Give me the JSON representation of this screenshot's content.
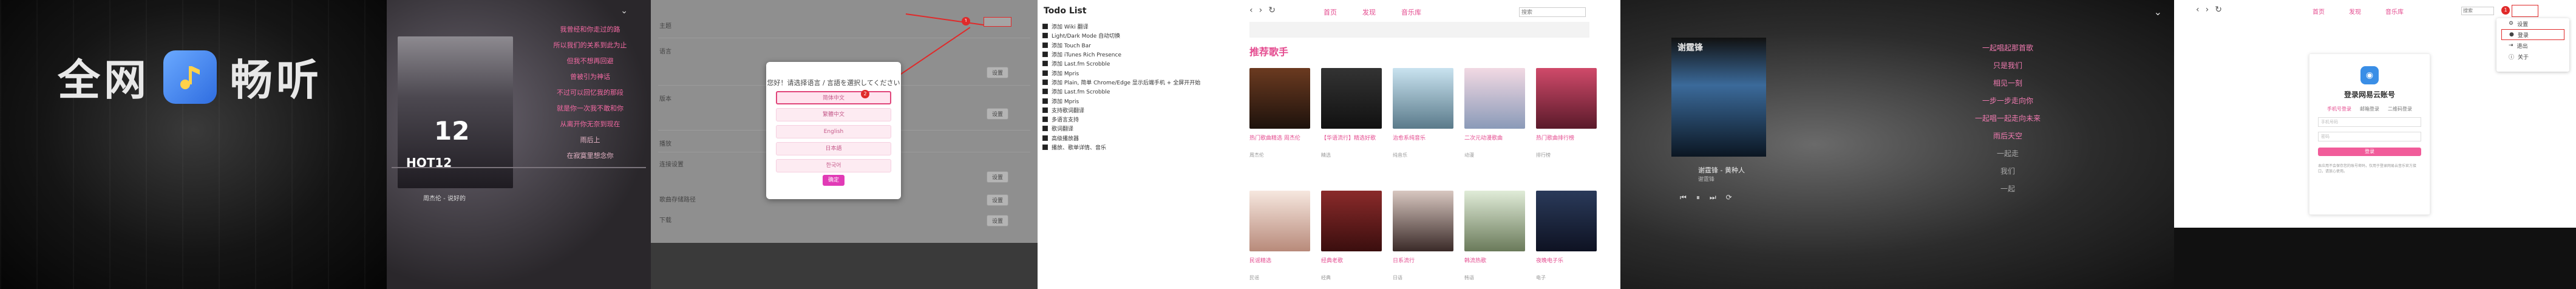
{
  "brand": {
    "left": "全网",
    "right": "畅听"
  },
  "player_small": {
    "lyrics": [
      "我曾经和你走过的路",
      "所以我们的关系到此为止",
      "但我不想再回避",
      "曾被引为神话",
      "不过可以回忆我的那段",
      "就是你一次我不敢和你",
      "从离开你无奈到现在",
      "雨后上",
      "在寂寞里想念你"
    ],
    "cover_title": "HOT12",
    "cover_num": "12",
    "song": "周杰伦 - 说好的"
  },
  "settings": {
    "rows": [
      "主题",
      "语言",
      "版本",
      "播放",
      "连接设置",
      "歌曲存储路径",
      "下载"
    ],
    "buttons": [
      "设置",
      "设置",
      "设置",
      "设置",
      "设置"
    ],
    "dialog_title": "您好！请选择语言 / 言語を選択してください",
    "languages": [
      "简体中文",
      "繁體中文",
      "English",
      "日本語",
      "한국어"
    ],
    "ok": "确定",
    "marks": [
      "1",
      "2"
    ]
  },
  "todo": {
    "title": "Todo List",
    "items": [
      "添加 Wiki 翻译",
      "Light/Dark Mode 自动切换",
      "添加 Touch Bar",
      "添加 iTunes Rich Presence",
      "添加 Last.fm Scrobble",
      "添加 Mpris",
      "添加 Plain, 简单 Chrome/Edge 显示后端手机 + 全屏开开始",
      "添加 Last.fm Scrobble",
      "添加 Mpris",
      "支持歌词翻译",
      "多语言支持",
      "歌词翻译",
      "高级播放器",
      "播放、歌单详情、音乐"
    ]
  },
  "web": {
    "nav": [
      "首页",
      "发现",
      "音乐库"
    ],
    "search": "搜索",
    "section": "推荐歌手",
    "cards": [
      {
        "t": "热门歌曲精选 周杰伦",
        "s": "周杰伦"
      },
      {
        "t": "【华语流行】精选好歌",
        "s": "精选"
      },
      {
        "t": "治愈系纯音乐",
        "s": "纯音乐"
      },
      {
        "t": "二次元动漫歌曲",
        "s": "动漫"
      },
      {
        "t": "热门歌曲排行榜",
        "s": "排行榜"
      },
      {
        "t": "民谣精选",
        "s": "民谣"
      },
      {
        "t": "经典老歌",
        "s": "经典"
      },
      {
        "t": "日系流行",
        "s": "日语"
      },
      {
        "t": "韩流热歌",
        "s": "韩语"
      },
      {
        "t": "夜晚电子乐",
        "s": "电子"
      }
    ]
  },
  "player_large": {
    "cover_title": "谢霆锋",
    "song": "谢霆锋 - 黄种人",
    "artist": "谢霆锋",
    "lyrics": [
      "一起唱起那首歌",
      "只是我们",
      "相见一刻",
      "一步一步走向你",
      "一起唱一起走向未来",
      "雨后天空",
      "一起走",
      "我们",
      "一起"
    ]
  },
  "login": {
    "nav": [
      "首页",
      "发现",
      "音乐库"
    ],
    "search": "搜索",
    "menu": [
      "设置",
      "登录",
      "退出",
      "关于"
    ],
    "title": "登录网易云账号",
    "tabs": [
      "手机号登录",
      "邮箱登录",
      "二维码登录"
    ],
    "phone_ph": "手机号码",
    "pw_ph": "密码",
    "submit": "登录",
    "note": "本应用不会保存您的账号密码，仅用于登录网易云音乐官方接口，请放心使用。",
    "mark": "1"
  }
}
